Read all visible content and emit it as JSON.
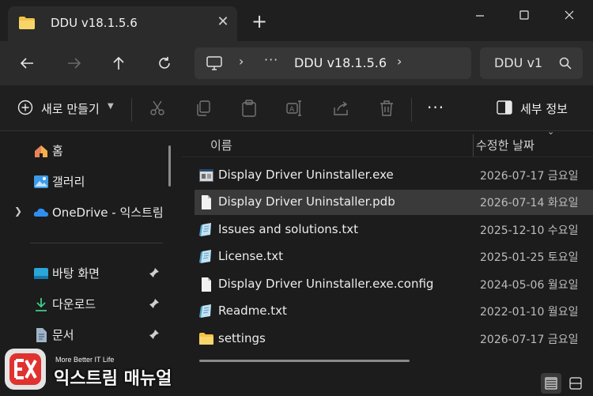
{
  "tab": {
    "title": "DDU v18.1.5.6",
    "close": "✕",
    "new_tab": "+"
  },
  "address": {
    "crumb": "DDU v18.1.5.6",
    "ellipsis": "···"
  },
  "search": {
    "placeholder": "DDU v1"
  },
  "commandbar": {
    "new_label": "새로 만들기",
    "more": "···",
    "details_label": "세부 정보"
  },
  "sidebar": {
    "items": [
      {
        "label": "홈"
      },
      {
        "label": "갤러리"
      },
      {
        "label": "OneDrive - 익스트림"
      },
      {
        "label": "바탕 화면"
      },
      {
        "label": "다운로드"
      },
      {
        "label": "문서"
      }
    ]
  },
  "filelist": {
    "headers": {
      "name": "이름",
      "date": "수정한 날짜"
    },
    "files": [
      {
        "name": "Display Driver Uninstaller.exe",
        "date": "2026-07-17 금요일",
        "icon": "exe-icon"
      },
      {
        "name": "Display Driver Uninstaller.pdb",
        "date": "2026-07-14 화요일",
        "icon": "file-icon",
        "selected": true
      },
      {
        "name": "Issues and solutions.txt",
        "date": "2025-12-10 수요일",
        "icon": "text-file-icon"
      },
      {
        "name": "License.txt",
        "date": "2025-01-25 토요일",
        "icon": "text-file-icon"
      },
      {
        "name": "Display Driver Uninstaller.exe.config",
        "date": "2024-05-06 월요일",
        "icon": "file-icon"
      },
      {
        "name": "Readme.txt",
        "date": "2022-01-10 월요일",
        "icon": "text-file-icon"
      },
      {
        "name": "settings",
        "date": "2026-07-17 금요일",
        "icon": "folder-icon"
      }
    ]
  },
  "watermark": {
    "tagline": "More Better IT Life",
    "brand": "익스트림 매뉴얼"
  },
  "colors": {
    "background": "#1c1c1c",
    "tab": "#2b2b2b",
    "selection": "#3a3a3a",
    "folder": "#f4c343",
    "onedrive": "#2f8ff0"
  }
}
